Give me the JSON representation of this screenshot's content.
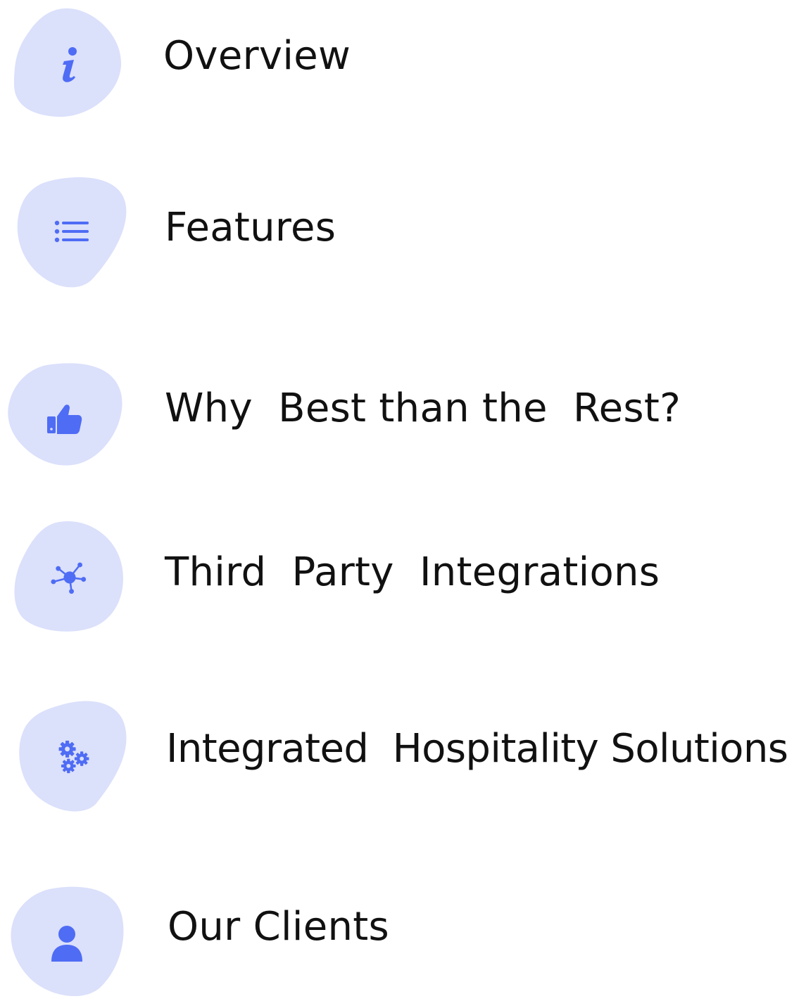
{
  "colors": {
    "blob_fill": "#dbe0fb",
    "icon_color": "#4f6cf5",
    "text_color": "#111111"
  },
  "nav": {
    "items": [
      {
        "label": "Overview",
        "icon": "info-icon"
      },
      {
        "label": "Features",
        "icon": "list-icon"
      },
      {
        "label": "Why  Best than the  Rest?",
        "icon": "thumbs-up-icon"
      },
      {
        "label": "Third  Party  Integrations",
        "icon": "network-icon"
      },
      {
        "label": "Integrated  Hospitality Solutions",
        "icon": "gears-icon"
      },
      {
        "label": "Our Clients",
        "icon": "user-icon"
      }
    ]
  }
}
